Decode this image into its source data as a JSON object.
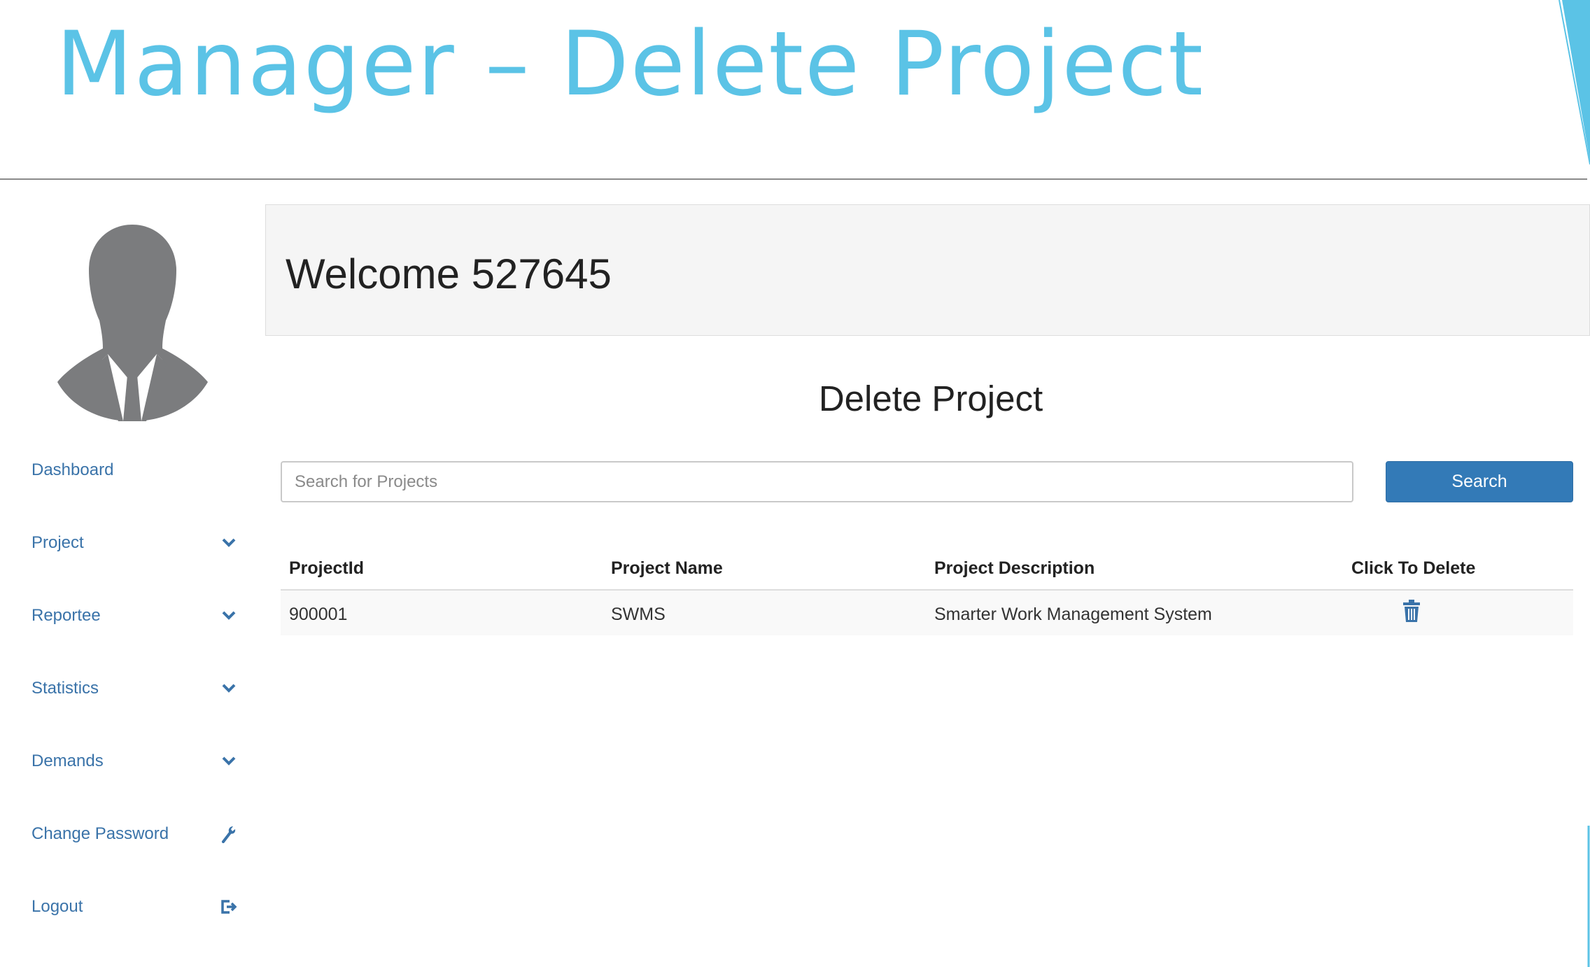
{
  "slide": {
    "title": "Manager – Delete Project"
  },
  "sidebar": {
    "items": [
      {
        "label": "Dashboard",
        "icon": ""
      },
      {
        "label": "Project",
        "icon": "chevron-down-icon"
      },
      {
        "label": "Reportee",
        "icon": "chevron-down-icon"
      },
      {
        "label": "Statistics",
        "icon": "chevron-down-icon"
      },
      {
        "label": "Demands",
        "icon": "chevron-down-icon"
      },
      {
        "label": "Change Password",
        "icon": "wrench-icon"
      },
      {
        "label": "Logout",
        "icon": "logout-icon"
      }
    ]
  },
  "welcome": {
    "text": "Welcome 527645"
  },
  "main": {
    "heading": "Delete Project",
    "search": {
      "placeholder": "Search for Projects",
      "value": "",
      "button_label": "Search"
    },
    "table": {
      "headers": [
        "ProjectId",
        "Project Name",
        "Project Description",
        "Click To Delete"
      ],
      "rows": [
        {
          "id": "900001",
          "name": "SWMS",
          "description": "Smarter Work Management System",
          "action_icon": "trash-icon"
        }
      ]
    }
  },
  "colors": {
    "title": "#5bc3e6",
    "link": "#3a73a9",
    "button": "#337ab7",
    "avatar": "#7b7c7e"
  }
}
